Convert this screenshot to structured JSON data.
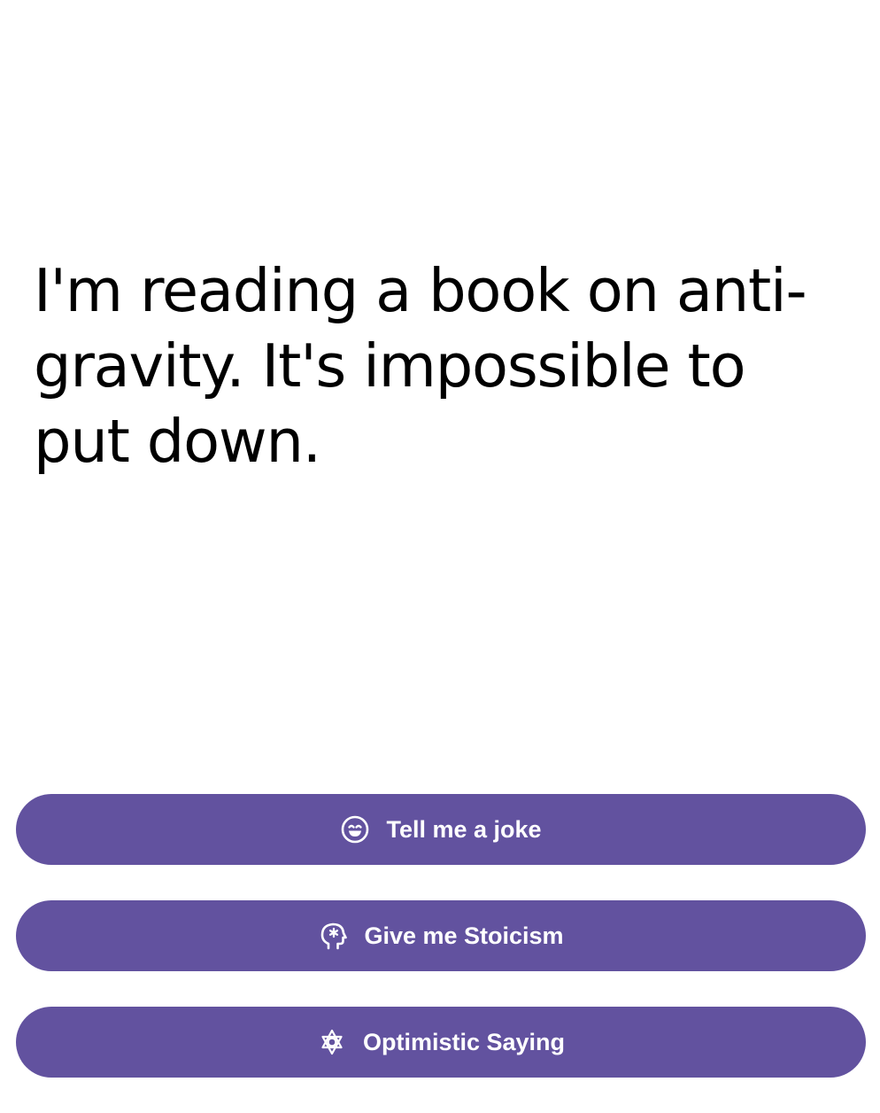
{
  "content": {
    "joke_text": "I'm reading a book on anti-gravity. It's impossible to put down."
  },
  "buttons": [
    {
      "label": "Tell me a joke",
      "icon": "smile-icon"
    },
    {
      "label": "Give me Stoicism",
      "icon": "head-mind-icon"
    },
    {
      "label": "Optimistic Saying",
      "icon": "sun-star-icon"
    }
  ],
  "colors": {
    "button_bg": "#62529f",
    "text": "#000000",
    "button_text": "#ffffff"
  }
}
